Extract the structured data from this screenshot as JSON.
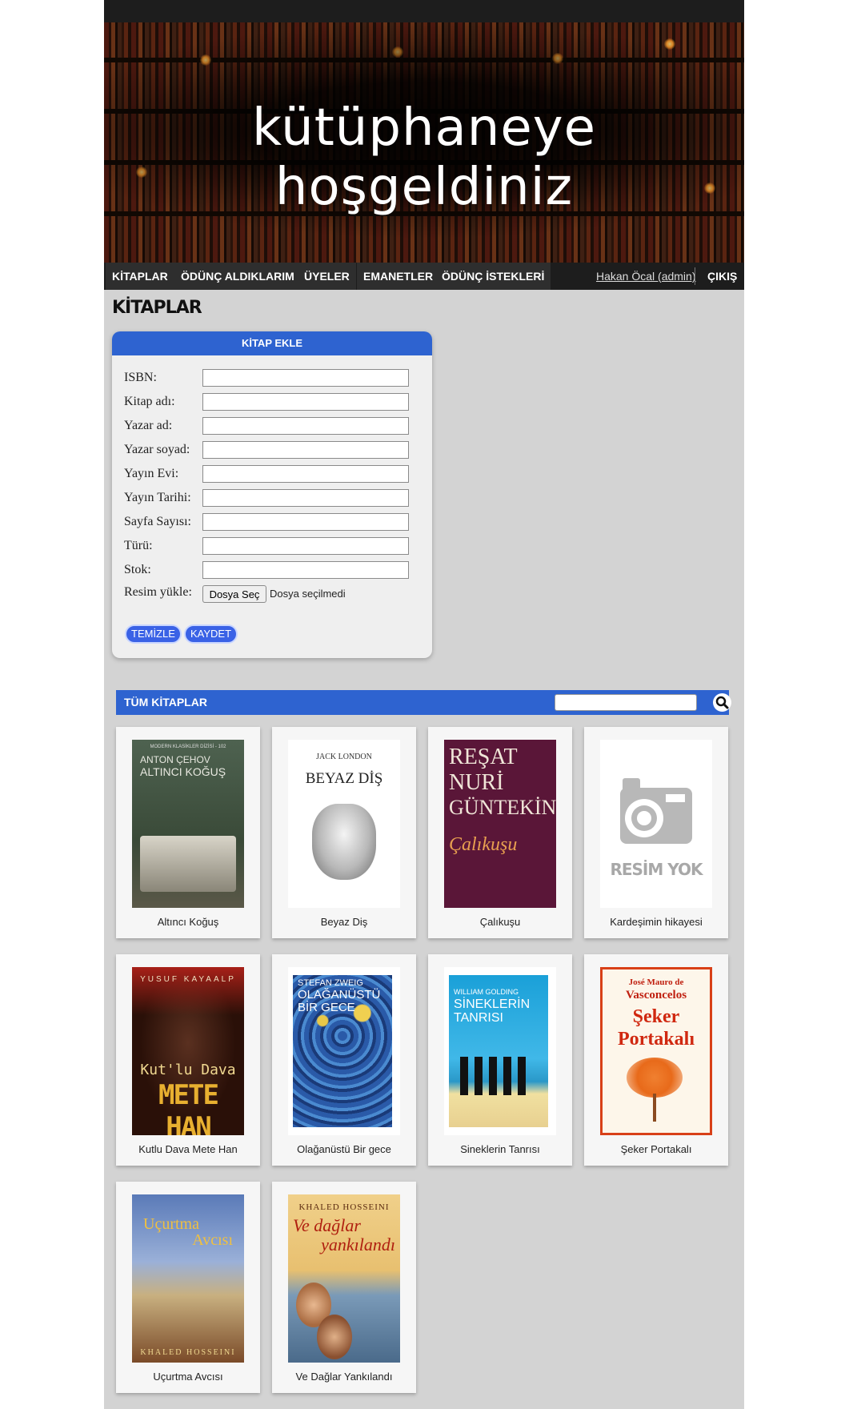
{
  "banner": {
    "title": "kütüphaneye hoşgeldiniz"
  },
  "nav": {
    "items": [
      "KİTAPLAR",
      "ÖDÜNÇ ALDIKLARIM",
      "ÜYELER",
      "EMANETLER",
      "ÖDÜNÇ İSTEKLERİ"
    ],
    "user": "Hakan Öcal (admin)",
    "logout": "ÇIKIŞ"
  },
  "page_title": "KİTAPLAR",
  "form": {
    "title": "KİTAP EKLE",
    "fields": [
      {
        "label": "ISBN:",
        "value": ""
      },
      {
        "label": "Kitap adı:",
        "value": ""
      },
      {
        "label": "Yazar ad:",
        "value": ""
      },
      {
        "label": "Yazar soyad:",
        "value": ""
      },
      {
        "label": "Yayın Evi:",
        "value": ""
      },
      {
        "label": "Yayın Tarihi:",
        "value": ""
      },
      {
        "label": "Sayfa Sayısı:",
        "value": ""
      },
      {
        "label": "Türü:",
        "value": ""
      },
      {
        "label": "Stok:",
        "value": ""
      }
    ],
    "file_label": "Resim yükle:",
    "file_button": "Dosya Seç",
    "file_status": "Dosya seçilmedi",
    "clear_button": "TEMİZLE",
    "save_button": "KAYDET"
  },
  "books_panel": {
    "title": "TÜM KİTAPLAR",
    "search_placeholder": "",
    "search_icon": "magnifier-icon"
  },
  "books": [
    {
      "title": "Altıncı Koğuş",
      "cover_lines": [
        "MODERN KLASİKLER DİZİSİ - 102",
        "ANTON ÇEHOV",
        "ALTINCI KOĞUŞ"
      ],
      "colors": [
        "#4a5a46",
        "#2e3a2c"
      ]
    },
    {
      "title": "Beyaz Diş",
      "cover_lines": [
        "JACK LONDON",
        "BEYAZ DİŞ"
      ],
      "colors": [
        "#ffffff",
        "#e8e8e8"
      ]
    },
    {
      "title": "Çalıkuşu",
      "cover_lines": [
        "REŞAT",
        "NURİ",
        "GÜNTEKİN",
        "Çalıkuşu"
      ],
      "colors": [
        "#5a1638",
        "#3e0e27"
      ]
    },
    {
      "title": "Kardeşimin hikayesi",
      "cover_lines": [
        "RESİM YOK"
      ],
      "colors": [
        "#ffffff",
        "#ffffff"
      ]
    },
    {
      "title": "Kutlu Dava Mete Han",
      "cover_lines": [
        "YUSUF KAYAALP",
        "Kut'lu Dava",
        "METE HAN"
      ],
      "colors": [
        "#8a1a16",
        "#3a0a08"
      ]
    },
    {
      "title": "Olağanüstü Bir gece",
      "cover_lines": [
        "STEFAN ZWEIG",
        "OLAĞANÜSTÜ",
        "BİR GECE"
      ],
      "colors": [
        "#2a5aa8",
        "#f0c840"
      ]
    },
    {
      "title": "Sineklerin Tanrısı",
      "cover_lines": [
        "WILLIAM GOLDING",
        "SİNEKLERİN",
        "TANRISI"
      ],
      "colors": [
        "#2aa8d8",
        "#f0e0a0"
      ]
    },
    {
      "title": "Şeker Portakalı",
      "cover_lines": [
        "José Mauro de",
        "Vasconcelos",
        "Şeker",
        "Portakalı"
      ],
      "colors": [
        "#fdf6ea",
        "#e86a1a"
      ]
    },
    {
      "title": "Uçurtma Avcısı",
      "cover_lines": [
        "Uçurtma",
        "Avcısı",
        "KHALED HOSSEINI"
      ],
      "colors": [
        "#6a8ac8",
        "#8a5a30"
      ]
    },
    {
      "title": "Ve Dağlar Yankılandı",
      "cover_lines": [
        "KHALED HOSSEINI",
        "Ve dağlar",
        "yankılandı"
      ],
      "colors": [
        "#e8c070",
        "#4a6a8a"
      ]
    }
  ],
  "colors": {
    "accent": "#2e63d0",
    "button": "#3a62e6",
    "nav": "#1d1d1d",
    "page_bg": "#d3d3d3"
  }
}
